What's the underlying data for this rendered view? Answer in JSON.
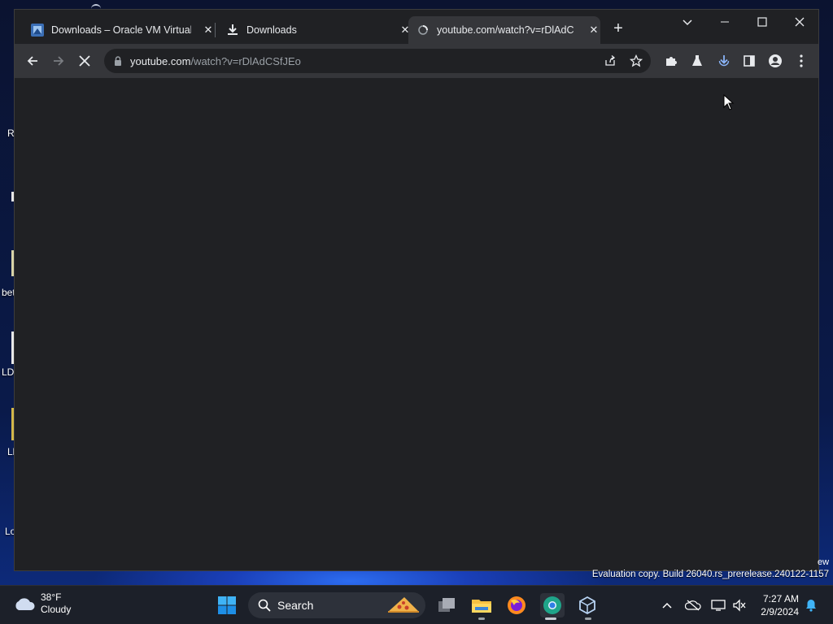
{
  "browser": {
    "tabs": [
      {
        "title": "Downloads – Oracle VM VirtualBox",
        "icon": "virtualbox-page-icon",
        "active": false
      },
      {
        "title": "Downloads",
        "icon": "download-icon",
        "active": false
      },
      {
        "title": "youtube.com/watch?v=rDlAdCSfJEo",
        "icon": "loading-globe-icon",
        "active": true
      }
    ],
    "address": {
      "host": "youtube.com",
      "path": "/watch?v=rDlAdCSfJEo"
    }
  },
  "desktop": {
    "fragments": [
      "R",
      "bet",
      "LD",
      "Ll",
      "Lo"
    ]
  },
  "watermark": {
    "text": "Evaluation copy. Build 26040.rs_prerelease.240122-1157",
    "edge_text": "ew"
  },
  "taskbar": {
    "weather": {
      "temp": "38°F",
      "condition": "Cloudy"
    },
    "search_label": "Search",
    "clock": {
      "time": "7:27 AM",
      "date": "2/9/2024"
    }
  },
  "colors": {
    "browser_bg": "#202124",
    "toolbar_bg": "#35363a",
    "taskbar_bg": "#1c2029",
    "accent_blue": "#8ab4f8"
  }
}
